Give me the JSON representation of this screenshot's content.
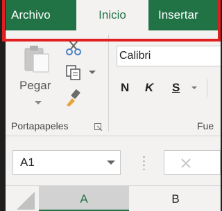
{
  "tabs": [
    {
      "label": "Archivo",
      "active": false
    },
    {
      "label": "Inicio",
      "active": true
    },
    {
      "label": "Insertar",
      "active": false
    }
  ],
  "clipboard": {
    "paste_label": "Pegar",
    "group_label": "Portapapeles"
  },
  "font": {
    "font_name": "Calibri",
    "bold_label": "N",
    "italic_label": "K",
    "underline_label": "S",
    "group_label_partial": "Fue"
  },
  "formula_bar": {
    "name_box_value": "A1"
  },
  "columns": [
    {
      "label": "A",
      "selected": true
    },
    {
      "label": "B",
      "selected": false
    }
  ],
  "colors": {
    "accent": "#217346",
    "highlight": "#e02020"
  }
}
